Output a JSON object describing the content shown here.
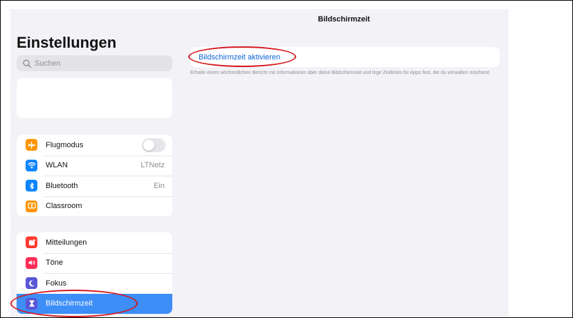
{
  "sidebar": {
    "title": "Einstellungen",
    "search_placeholder": "Suchen",
    "group1": [
      {
        "label": "Flugmodus",
        "icon": "airplane-icon",
        "color": "#ff9500",
        "control": "toggle",
        "toggle_on": false
      },
      {
        "label": "WLAN",
        "icon": "wifi-icon",
        "color": "#0a84ff",
        "value": "LTNetz"
      },
      {
        "label": "Bluetooth",
        "icon": "bluetooth-icon",
        "color": "#0a84ff",
        "value": "Ein"
      },
      {
        "label": "Classroom",
        "icon": "classroom-icon",
        "color": "#ff9500"
      }
    ],
    "group2": [
      {
        "label": "Mitteilungen",
        "icon": "notifications-icon",
        "color": "#ff3b30"
      },
      {
        "label": "Töne",
        "icon": "sound-icon",
        "color": "#ff2d55"
      },
      {
        "label": "Fokus",
        "icon": "moon-icon",
        "color": "#5856d6"
      },
      {
        "label": "Bildschirmzeit",
        "icon": "hourglass-icon",
        "color": "#5856d6",
        "selected": true
      }
    ]
  },
  "detail": {
    "nav_title": "Bildschirmzeit",
    "activate_label": "Bildschirmzeit aktivieren",
    "description": "Erhalte einen wöchentlichen Bericht mit Informationen über deine Bildschirmzeit und lege Zeitlimits für Apps fest, die du verwalten möchtest."
  },
  "colors": {
    "accent": "#0a64d8",
    "selected_row": "#3d8ef7",
    "annotation": "#d4171e",
    "background": "#f2f2f7"
  }
}
